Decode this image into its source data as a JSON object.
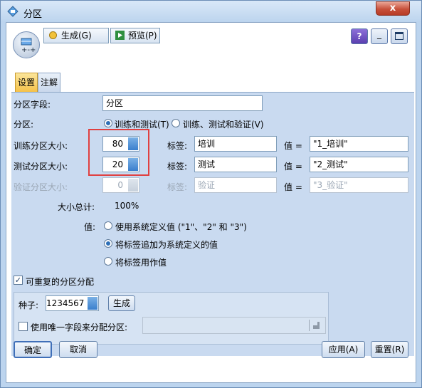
{
  "window": {
    "title": "分区",
    "close_label": "x"
  },
  "toolbar": {
    "generate_label": "生成(G)",
    "preview_label": "预览(P)",
    "help_label": "?",
    "minimize_label": "_",
    "maximize_label": ""
  },
  "tabs": [
    {
      "label": "设置",
      "active": true
    },
    {
      "label": "注解",
      "active": false
    }
  ],
  "form": {
    "partition_field_label": "分区字段:",
    "partition_field_value": "分区",
    "partitions_label": "分区:",
    "partitions_options": [
      {
        "label": "训练和测试(T)",
        "selected": true
      },
      {
        "label": "训练、测试和验证(V)",
        "selected": false
      }
    ],
    "train_size_label": "训练分区大小:",
    "train_size_value": "80",
    "test_size_label": "测试分区大小:",
    "test_size_value": "20",
    "validate_size_label": "验证分区大小:",
    "validate_size_value": "0",
    "tag_label": "标签:",
    "value_label": "值 =",
    "train_tag": "培训",
    "train_value": "\"1_培训\"",
    "test_tag": "测试",
    "test_value": "\"2_测试\"",
    "validate_tag": "验证",
    "validate_value": "\"3_验证\"",
    "total_label": "大小总计:",
    "total_value": "100%",
    "values_label": "值:",
    "values_options": [
      {
        "label": "使用系统定义值 (\"1\"、\"2\" 和 \"3\")",
        "selected": false
      },
      {
        "label": "将标签追加为系统定义的值",
        "selected": true
      },
      {
        "label": "将标签用作值",
        "selected": false
      }
    ],
    "repeatable_label": "可重复的分区分配",
    "repeatable_checked": true,
    "seed_label": "种子:",
    "seed_value": "1234567",
    "seed_generate_label": "生成",
    "unique_field_label": "使用唯一字段来分配分区:",
    "unique_field_checked": false
  },
  "buttons": {
    "ok": "确定",
    "cancel": "取消",
    "apply": "应用(A)",
    "reset": "重置(R)"
  },
  "colors": {
    "accent_blue": "#2d6fb7",
    "highlight_red": "#e04040",
    "tab_active": "#f5c24a"
  }
}
